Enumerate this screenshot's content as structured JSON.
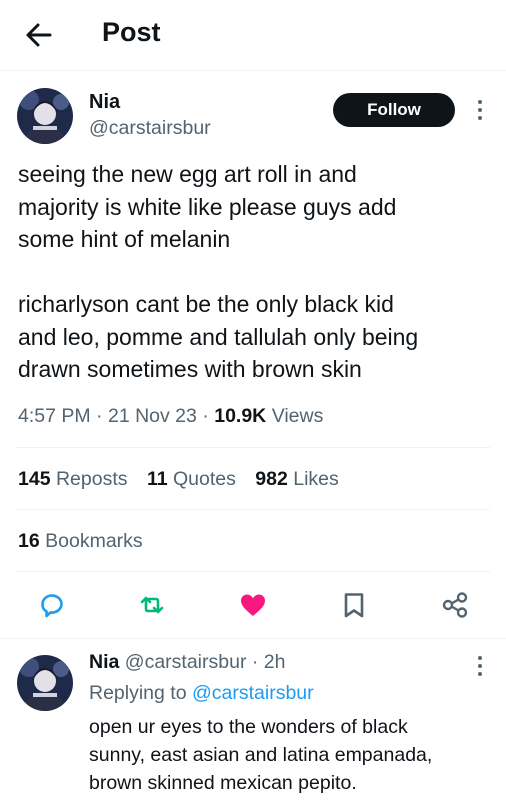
{
  "header": {
    "title": "Post",
    "back_icon": "arrow-left-icon"
  },
  "post": {
    "author": {
      "name": "Nia",
      "handle": "@carstairsbur"
    },
    "follow_label": "Follow",
    "text": "seeing the new egg art roll in and\nmajority is white like please guys add\nsome hint of melanin\n\nricharlyson cant be the only black kid\nand leo, pomme and tallulah only being\ndrawn sometimes with brown skin",
    "time": "4:57 PM",
    "date": "21 Nov 23",
    "views_count": "10.9K",
    "views_label": "Views",
    "stats": {
      "reposts_count": "145",
      "reposts_label": "Reposts",
      "quotes_count": "11",
      "quotes_label": "Quotes",
      "likes_count": "982",
      "likes_label": "Likes",
      "bookmarks_count": "16",
      "bookmarks_label": "Bookmarks"
    },
    "actions": [
      "reply-icon",
      "repost-icon",
      "like-icon",
      "bookmark-icon",
      "share-icon"
    ],
    "colors": {
      "repost": "#00ba7c",
      "like": "#f91880",
      "link": "#1d9bf0",
      "secondary": "#536471"
    }
  },
  "reply": {
    "name": "Nia",
    "handle": "@carstairsbur",
    "time": "2h",
    "replying_label": "Replying to",
    "replying_to": "@carstairsbur",
    "text": "open ur eyes to the wonders of black\nsunny, east asian and latina empanada,\nbrown skinned mexican pepito."
  }
}
